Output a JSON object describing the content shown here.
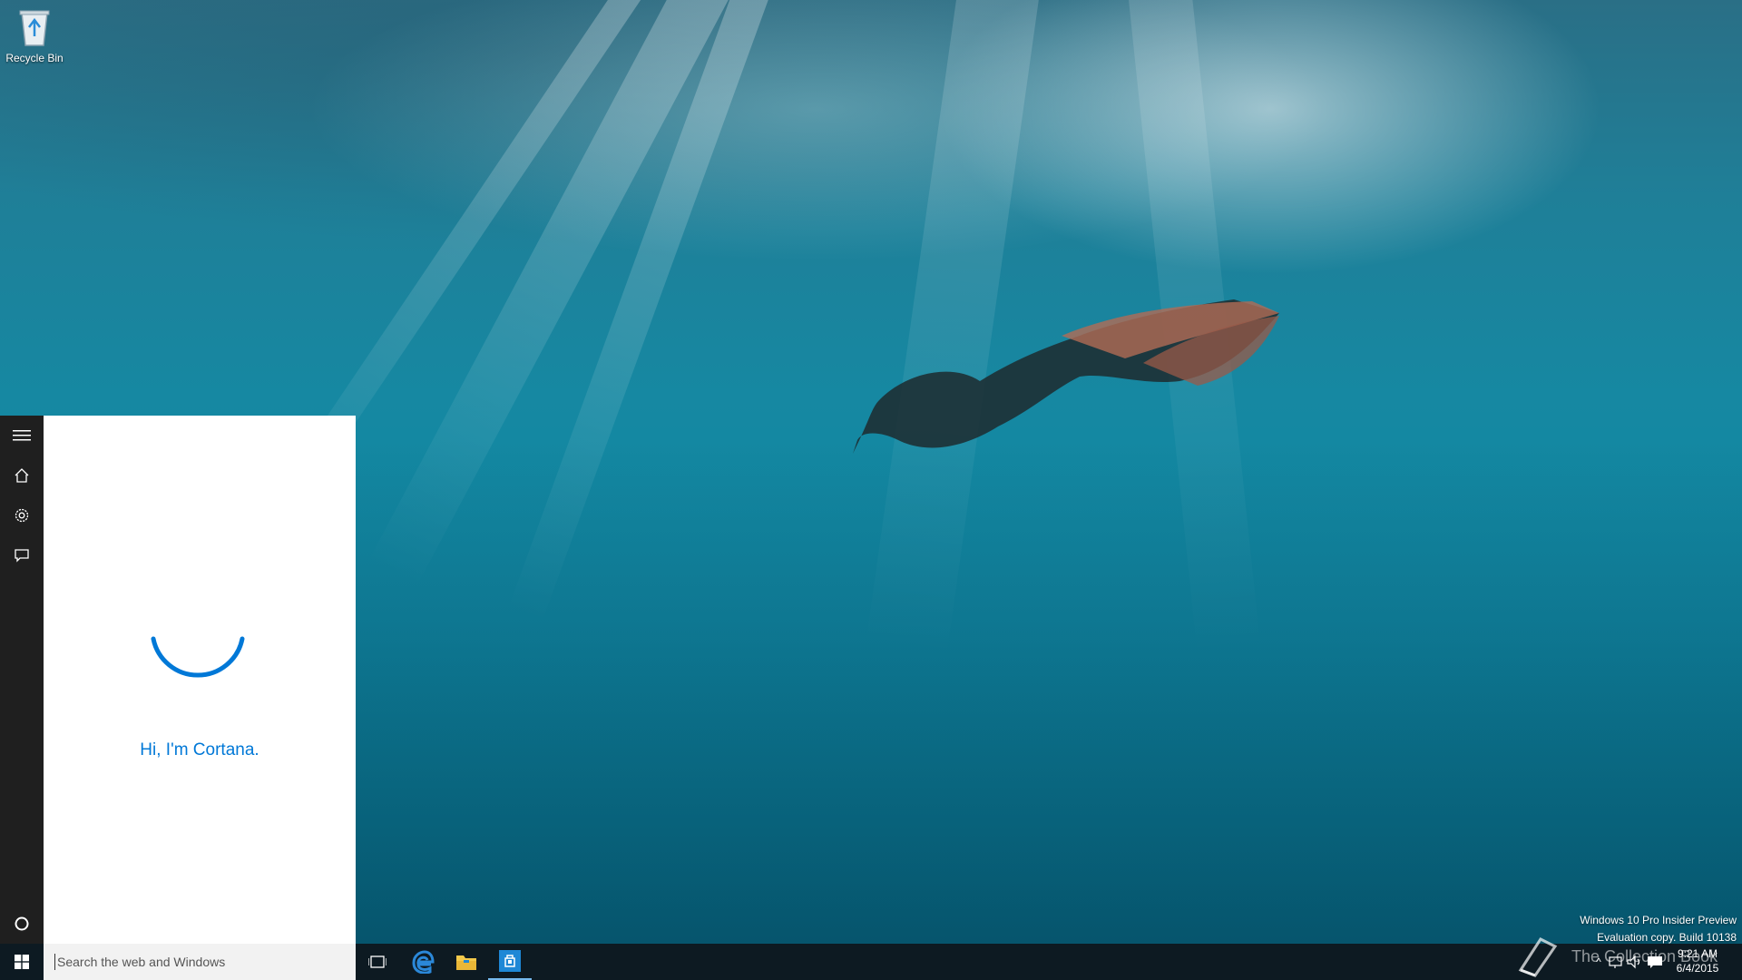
{
  "desktop": {
    "icons": [
      {
        "label": "Recycle Bin",
        "icon": "recycle-bin-icon"
      }
    ]
  },
  "cortana": {
    "rail": [
      {
        "name": "menu",
        "icon": "hamburger-icon"
      },
      {
        "name": "home",
        "icon": "home-icon"
      },
      {
        "name": "settings",
        "icon": "gear-icon"
      },
      {
        "name": "feedback",
        "icon": "feedback-icon"
      },
      {
        "name": "cortana",
        "icon": "cortana-circle-icon"
      }
    ],
    "greeting": "Hi, I'm Cortana.",
    "accent": "#0078d7"
  },
  "taskbar": {
    "search_placeholder": "Search the web and Windows",
    "pinned": [
      {
        "name": "task-view",
        "icon": "task-view-icon"
      },
      {
        "name": "edge",
        "icon": "edge-icon"
      },
      {
        "name": "file-explorer",
        "icon": "folder-icon"
      },
      {
        "name": "store",
        "icon": "store-icon"
      }
    ],
    "clock": {
      "time": "9:21 AM",
      "date": "6/4/2015"
    }
  },
  "watermark": {
    "line1": "Windows 10 Pro Insider Preview",
    "line2": "Evaluation copy. Build 10138"
  },
  "logo_text": "The Collection Book"
}
